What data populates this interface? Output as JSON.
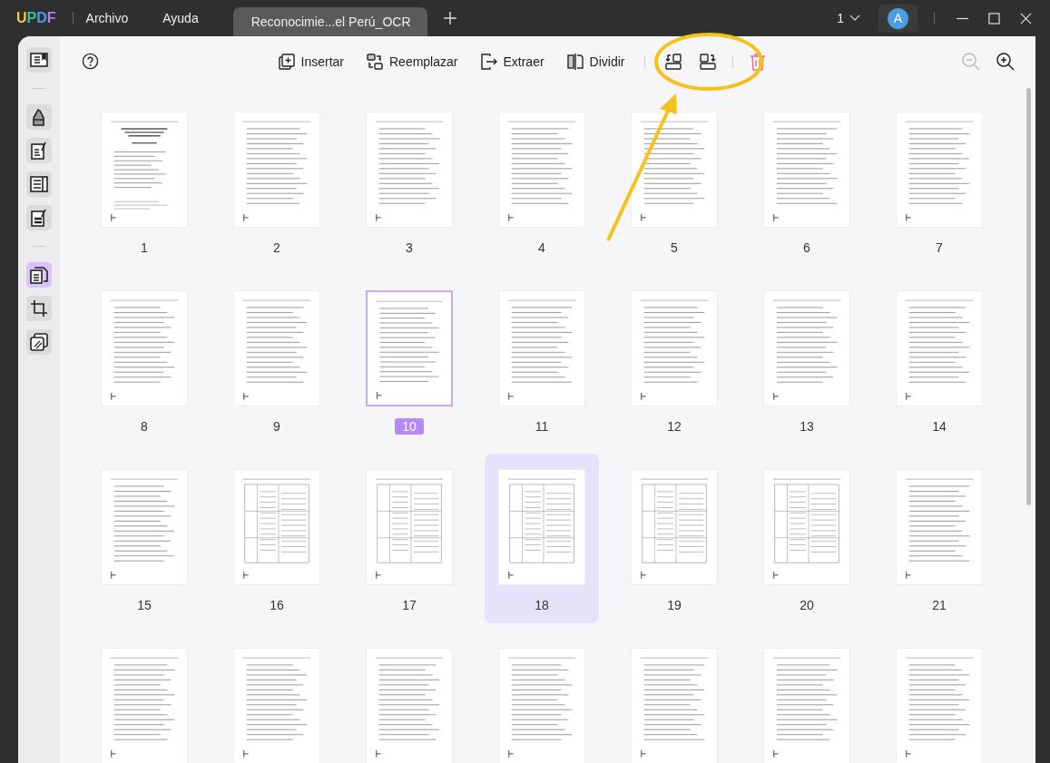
{
  "titlebar": {
    "logo": "UPDF",
    "menu": [
      "Archivo",
      "Ayuda"
    ],
    "tab": {
      "title": "Reconocimie...el Perú_OCR"
    },
    "page_selector": "1",
    "avatar": "A"
  },
  "sidebar": {
    "items": [
      {
        "selected": false
      },
      {
        "selected": false
      },
      {
        "selected": false
      },
      {
        "selected": false
      },
      {
        "selected": false
      },
      {
        "selected": true
      },
      {
        "selected": false
      },
      {
        "selected": false
      }
    ]
  },
  "toolbar": {
    "actions": [
      {
        "label": "Insertar",
        "kind": "insert"
      },
      {
        "label": "Reemplazar",
        "kind": "replace"
      },
      {
        "label": "Extraer",
        "kind": "extract"
      },
      {
        "label": "Dividir",
        "kind": "split"
      }
    ],
    "icon_buttons": [
      {
        "kind": "rotate-left"
      },
      {
        "kind": "rotate-right"
      },
      {
        "kind": "delete"
      }
    ],
    "zoom": [
      {
        "kind": "zoom-out",
        "disabled": true
      },
      {
        "kind": "zoom-in",
        "disabled": false
      }
    ]
  },
  "pages": [
    {
      "label": "1",
      "kind": "title",
      "selected": false,
      "hovered": false
    },
    {
      "label": "2",
      "kind": "text",
      "selected": false,
      "hovered": false
    },
    {
      "label": "3",
      "kind": "text",
      "selected": false,
      "hovered": false
    },
    {
      "label": "4",
      "kind": "text",
      "selected": false,
      "hovered": false
    },
    {
      "label": "5",
      "kind": "text",
      "selected": false,
      "hovered": false
    },
    {
      "label": "6",
      "kind": "text",
      "selected": false,
      "hovered": false
    },
    {
      "label": "7",
      "kind": "text",
      "selected": false,
      "hovered": false
    },
    {
      "label": "8",
      "kind": "text",
      "selected": false,
      "hovered": false
    },
    {
      "label": "9",
      "kind": "text",
      "selected": false,
      "hovered": false
    },
    {
      "label": "10",
      "kind": "text",
      "selected": true,
      "hovered": false
    },
    {
      "label": "11",
      "kind": "text",
      "selected": false,
      "hovered": false
    },
    {
      "label": "12",
      "kind": "text",
      "selected": false,
      "hovered": false
    },
    {
      "label": "13",
      "kind": "text",
      "selected": false,
      "hovered": false
    },
    {
      "label": "14",
      "kind": "text",
      "selected": false,
      "hovered": false
    },
    {
      "label": "15",
      "kind": "text",
      "selected": false,
      "hovered": false
    },
    {
      "label": "16",
      "kind": "table",
      "selected": false,
      "hovered": false
    },
    {
      "label": "17",
      "kind": "table",
      "selected": false,
      "hovered": false
    },
    {
      "label": "18",
      "kind": "table",
      "selected": false,
      "hovered": true
    },
    {
      "label": "19",
      "kind": "table",
      "selected": false,
      "hovered": false
    },
    {
      "label": "20",
      "kind": "table",
      "selected": false,
      "hovered": false
    },
    {
      "label": "21",
      "kind": "text",
      "selected": false,
      "hovered": false
    },
    {
      "kind": "text",
      "selected": false,
      "hovered": false
    },
    {
      "kind": "text",
      "selected": false,
      "hovered": false
    },
    {
      "kind": "text",
      "selected": false,
      "hovered": false
    },
    {
      "kind": "text",
      "selected": false,
      "hovered": false
    },
    {
      "kind": "text",
      "selected": false,
      "hovered": false
    },
    {
      "kind": "text",
      "selected": false,
      "hovered": false
    },
    {
      "kind": "text",
      "selected": false,
      "hovered": false
    }
  ]
}
